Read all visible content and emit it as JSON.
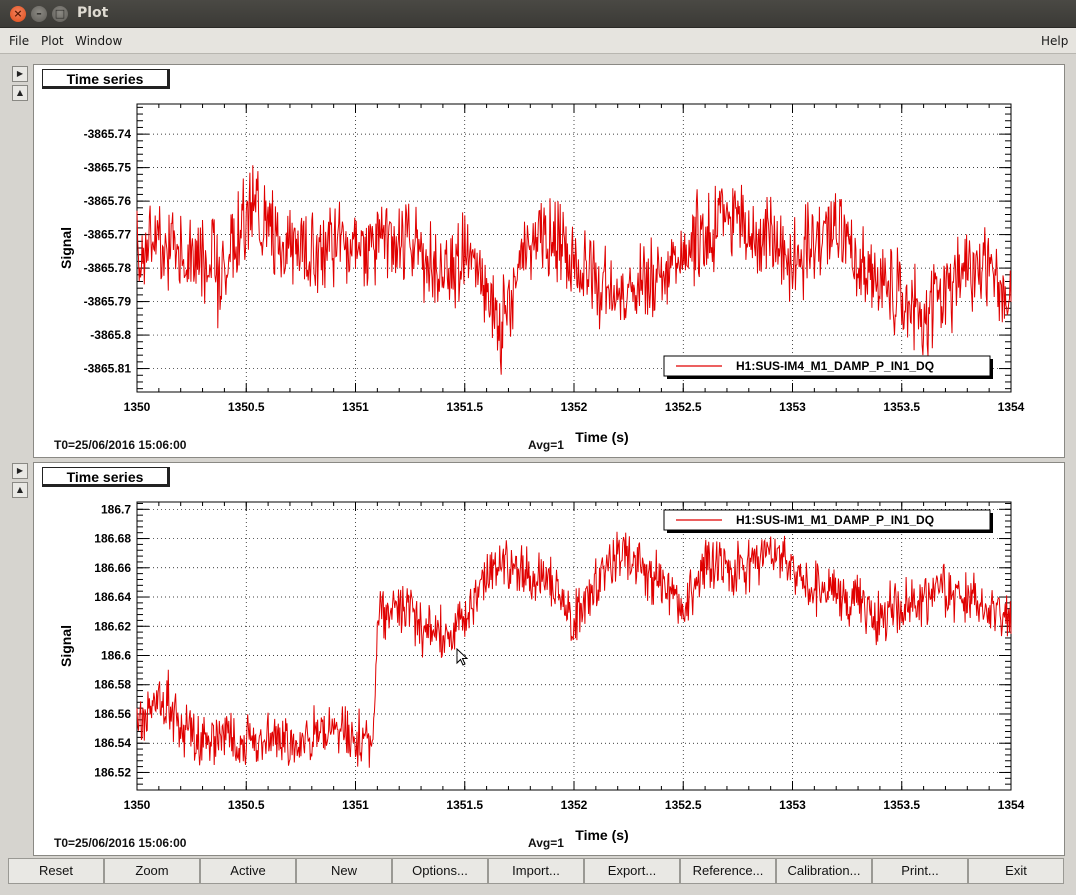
{
  "window": {
    "title": "Plot"
  },
  "menu": {
    "file": "File",
    "plot": "Plot",
    "window": "Window",
    "help": "Help"
  },
  "panels": [
    {
      "title": "Time series",
      "t0": "T0=25/06/2016 15:06:00",
      "avg": "Avg=1",
      "chart_data": {
        "type": "line",
        "xlabel": "Time (s)",
        "ylabel": "Signal",
        "xlim": [
          1350,
          1354
        ],
        "ylim": [
          -3865.817,
          -3865.731
        ],
        "xticks": [
          "1350",
          "1350.5",
          "1351",
          "1351.5",
          "1352",
          "1352.5",
          "1353",
          "1353.5",
          "1354"
        ],
        "yticks": [
          -3865.74,
          -3865.75,
          -3865.76,
          -3865.77,
          -3865.78,
          -3865.79,
          -3865.8,
          -3865.81
        ],
        "yticklabels": [
          "-3865.74",
          "-3865.75",
          "-3865.76",
          "-3865.77",
          "-3865.78",
          "-3865.79",
          "-3865.8",
          "-3865.81"
        ],
        "grid": true,
        "legend_position": "bottom-right",
        "series": [
          {
            "name": "H1:SUS-IM4_M1_DAMP_P_IN1_DQ",
            "color": "#e00000",
            "x": [
              1350,
              1350.1,
              1350.2,
              1350.3,
              1350.4,
              1350.5,
              1350.55,
              1350.6,
              1350.7,
              1350.8,
              1350.9,
              1351,
              1351.1,
              1351.2,
              1351.3,
              1351.4,
              1351.5,
              1351.6,
              1351.65,
              1351.7,
              1351.8,
              1351.9,
              1352,
              1352.1,
              1352.2,
              1352.3,
              1352.4,
              1352.5,
              1352.6,
              1352.7,
              1352.75,
              1352.8,
              1352.9,
              1353,
              1353.1,
              1353.2,
              1353.3,
              1353.4,
              1353.5,
              1353.6,
              1353.7,
              1353.8,
              1353.9,
              1354
            ],
            "y": [
              -3865.775,
              -3865.77,
              -3865.778,
              -3865.775,
              -3865.78,
              -3865.765,
              -3865.76,
              -3865.768,
              -3865.772,
              -3865.778,
              -3865.775,
              -3865.774,
              -3865.772,
              -3865.77,
              -3865.775,
              -3865.78,
              -3865.778,
              -3865.785,
              -3865.8,
              -3865.79,
              -3865.77,
              -3865.77,
              -3865.78,
              -3865.785,
              -3865.79,
              -3865.785,
              -3865.78,
              -3865.775,
              -3865.77,
              -3865.765,
              -3865.76,
              -3865.772,
              -3865.77,
              -3865.778,
              -3865.772,
              -3865.77,
              -3865.778,
              -3865.785,
              -3865.79,
              -3865.795,
              -3865.788,
              -3865.78,
              -3865.782,
              -3865.79
            ]
          }
        ]
      }
    },
    {
      "title": "Time series",
      "t0": "T0=25/06/2016 15:06:00",
      "avg": "Avg=1",
      "chart_data": {
        "type": "line",
        "xlabel": "Time (s)",
        "ylabel": "Signal",
        "xlim": [
          1350,
          1354
        ],
        "ylim": [
          186.508,
          186.705
        ],
        "xticks": [
          "1350",
          "1350.5",
          "1351",
          "1351.5",
          "1352",
          "1352.5",
          "1353",
          "1353.5",
          "1354"
        ],
        "yticks": [
          186.52,
          186.54,
          186.56,
          186.58,
          186.6,
          186.62,
          186.64,
          186.66,
          186.68,
          186.7
        ],
        "yticklabels": [
          "186.52",
          "186.54",
          "186.56",
          "186.58",
          "186.6",
          "186.62",
          "186.64",
          "186.66",
          "186.68",
          "186.7"
        ],
        "grid": true,
        "legend_position": "top-right",
        "series": [
          {
            "name": "H1:SUS-IM1_M1_DAMP_P_IN1_DQ",
            "color": "#e00000",
            "x": [
              1350,
              1350.1,
              1350.2,
              1350.3,
              1350.4,
              1350.5,
              1350.6,
              1350.7,
              1350.8,
              1350.9,
              1351,
              1351.08,
              1351.1,
              1351.2,
              1351.3,
              1351.4,
              1351.5,
              1351.6,
              1351.7,
              1351.8,
              1351.9,
              1352,
              1352.1,
              1352.2,
              1352.3,
              1352.4,
              1352.5,
              1352.6,
              1352.7,
              1352.8,
              1352.9,
              1353,
              1353.1,
              1353.2,
              1353.3,
              1353.4,
              1353.5,
              1353.6,
              1353.7,
              1353.8,
              1353.9,
              1354
            ],
            "y": [
              186.55,
              186.57,
              186.55,
              186.54,
              186.545,
              186.54,
              186.545,
              186.54,
              186.545,
              186.55,
              186.545,
              186.54,
              186.63,
              186.63,
              186.62,
              186.615,
              186.625,
              186.66,
              186.66,
              186.655,
              186.65,
              186.625,
              186.645,
              186.67,
              186.66,
              186.65,
              186.63,
              186.665,
              186.66,
              186.66,
              186.67,
              186.66,
              186.645,
              186.645,
              186.635,
              186.625,
              186.635,
              186.64,
              186.645,
              186.64,
              186.63,
              186.625
            ]
          }
        ]
      }
    }
  ],
  "buttons": [
    "Reset",
    "Zoom",
    "Active",
    "New",
    "Options...",
    "Import...",
    "Export...",
    "Reference...",
    "Calibration...",
    "Print...",
    "Exit"
  ]
}
